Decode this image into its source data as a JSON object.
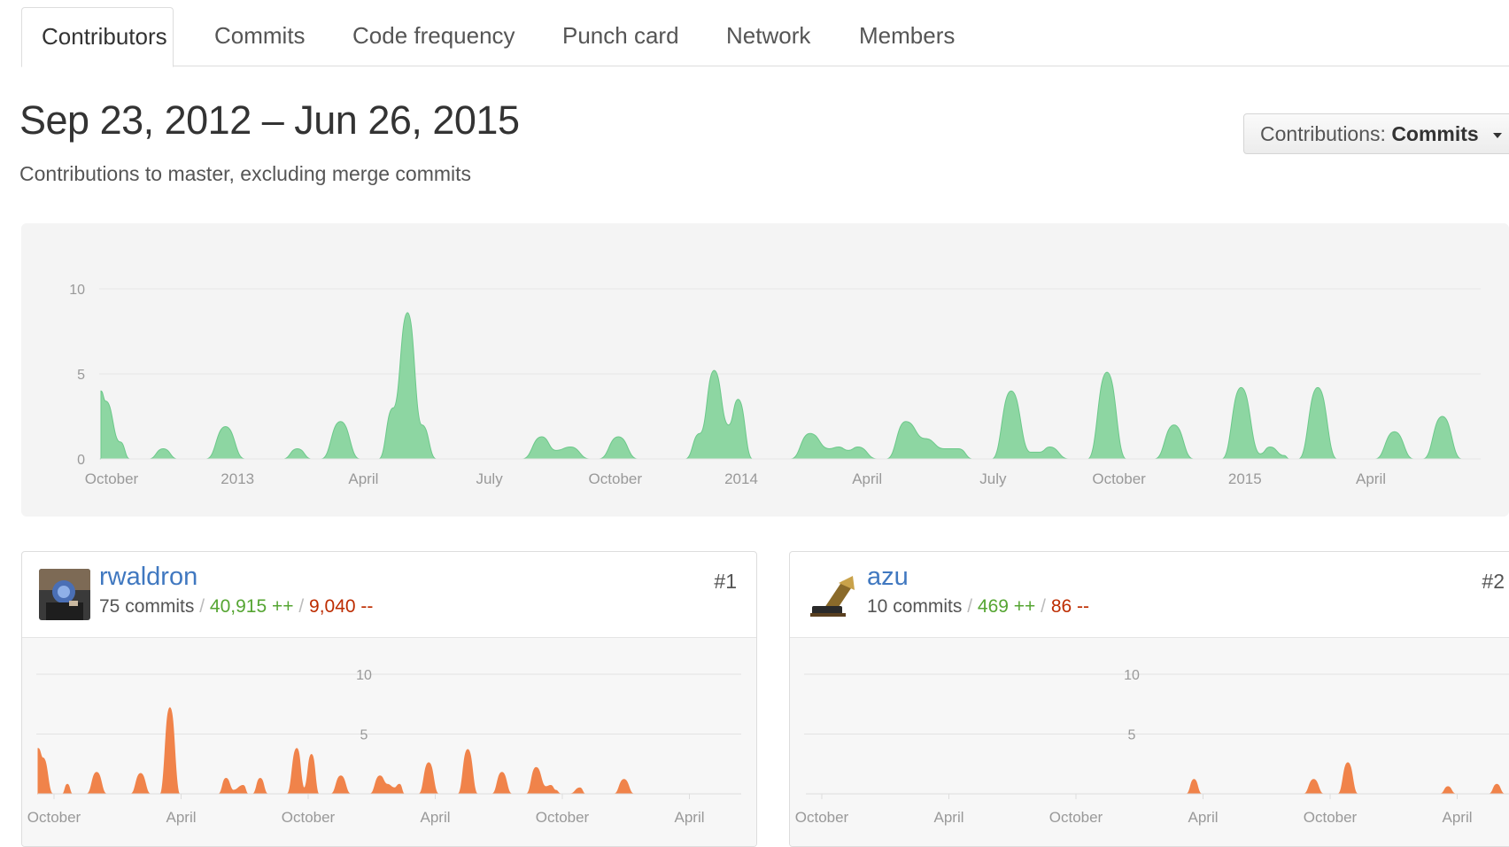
{
  "tabs": [
    {
      "label": "Contributors",
      "active": true
    },
    {
      "label": "Commits",
      "active": false
    },
    {
      "label": "Code frequency",
      "active": false
    },
    {
      "label": "Punch card",
      "active": false
    },
    {
      "label": "Network",
      "active": false
    },
    {
      "label": "Members",
      "active": false
    }
  ],
  "header": {
    "range_title": "Sep 23, 2012 – Jun 26, 2015",
    "subtitle": "Contributions to master, excluding merge commits",
    "contributions_label": "Contributions:",
    "contributions_value": "Commits"
  },
  "colors": {
    "main_area": "#8dd6a2",
    "main_area_stroke": "#6cc88a",
    "contributor_area": "#f0834a",
    "link": "#4078c0",
    "additions": "#55a532",
    "deletions": "#bd2c00"
  },
  "chart_data": [
    {
      "type": "area",
      "title": "",
      "ylim": [
        0,
        10
      ],
      "y_ticks": [
        "0",
        "5",
        "10"
      ],
      "grid": true,
      "x_ticks": [
        "October",
        "2013",
        "April",
        "July",
        "October",
        "2014",
        "April",
        "July",
        "October",
        "2015",
        "April"
      ],
      "x_unit": "weeks since Sep 23, 2012",
      "x_range": [
        0,
        144
      ],
      "series": [
        {
          "points": [
            [
              0,
              4
            ],
            [
              0.5,
              3.4
            ],
            [
              2,
              1
            ],
            [
              3,
              0
            ],
            [
              5,
              0
            ],
            [
              6.5,
              0.6
            ],
            [
              8,
              0
            ],
            [
              11,
              0
            ],
            [
              13,
              1.9
            ],
            [
              15,
              0
            ],
            [
              19,
              0
            ],
            [
              20.5,
              0.6
            ],
            [
              22,
              0
            ],
            [
              23,
              0
            ],
            [
              25,
              2.2
            ],
            [
              27,
              0
            ],
            [
              29,
              0
            ],
            [
              30.5,
              3
            ],
            [
              32,
              8.6
            ],
            [
              33.5,
              2
            ],
            [
              35,
              0
            ],
            [
              44,
              0
            ],
            [
              46,
              1.3
            ],
            [
              47.5,
              0.5
            ],
            [
              49,
              0.7
            ],
            [
              51,
              0
            ],
            [
              52,
              0
            ],
            [
              54,
              1.3
            ],
            [
              56,
              0
            ],
            [
              61,
              0
            ],
            [
              62.5,
              1.5
            ],
            [
              64,
              5.2
            ],
            [
              65.5,
              2
            ],
            [
              66.5,
              3.5
            ],
            [
              68,
              0
            ],
            [
              69,
              0
            ],
            [
              72,
              0
            ],
            [
              74,
              1.5
            ],
            [
              76,
              0.6
            ],
            [
              77,
              0.7
            ],
            [
              78,
              0.5
            ],
            [
              79,
              0.7
            ],
            [
              81,
              0
            ],
            [
              82,
              0
            ],
            [
              84,
              2.2
            ],
            [
              86,
              1.2
            ],
            [
              88,
              0.6
            ],
            [
              89.5,
              0.6
            ],
            [
              91,
              0
            ],
            [
              93,
              0
            ],
            [
              95,
              4
            ],
            [
              97,
              0.4
            ],
            [
              98,
              0.4
            ],
            [
              99,
              0.7
            ],
            [
              101,
              0
            ],
            [
              103,
              0
            ],
            [
              105,
              5.1
            ],
            [
              107,
              0
            ],
            [
              110,
              0
            ],
            [
              112,
              2
            ],
            [
              114,
              0
            ],
            [
              117,
              0
            ],
            [
              119,
              4.2
            ],
            [
              121,
              0.3
            ],
            [
              122,
              0.7
            ],
            [
              123.5,
              0.2
            ],
            [
              124,
              0
            ],
            [
              125,
              0
            ],
            [
              127,
              4.2
            ],
            [
              129,
              0
            ],
            [
              131,
              0
            ],
            [
              133,
              0
            ],
            [
              135,
              1.6
            ],
            [
              137,
              0
            ],
            [
              138,
              0
            ],
            [
              140,
              2.5
            ],
            [
              142,
              0
            ],
            [
              144,
              0
            ]
          ]
        }
      ]
    },
    {
      "type": "area",
      "title": "rwaldron",
      "ylim": [
        0,
        10
      ],
      "y_ticks": [
        "5",
        "10"
      ],
      "grid": true,
      "x_ticks": [
        "October",
        "April",
        "October",
        "April",
        "October",
        "April"
      ],
      "x_unit": "weeks",
      "x_range": [
        0,
        144
      ],
      "series": [
        {
          "points": [
            [
              0,
              3.8
            ],
            [
              1,
              3
            ],
            [
              3,
              0
            ],
            [
              5,
              0
            ],
            [
              6,
              0.8
            ],
            [
              7,
              0
            ],
            [
              10,
              0
            ],
            [
              12,
              1.8
            ],
            [
              14,
              0
            ],
            [
              19,
              0
            ],
            [
              21,
              1.7
            ],
            [
              23,
              0
            ],
            [
              25,
              0
            ],
            [
              27,
              7.2
            ],
            [
              29,
              0
            ],
            [
              37,
              0
            ],
            [
              38.5,
              1.3
            ],
            [
              40,
              0.3
            ],
            [
              42,
              0.7
            ],
            [
              43,
              0
            ],
            [
              44,
              0
            ],
            [
              45.5,
              1.3
            ],
            [
              47,
              0
            ],
            [
              51,
              0
            ],
            [
              53,
              3.8
            ],
            [
              54.5,
              0.5
            ],
            [
              56,
              3.3
            ],
            [
              57.5,
              0
            ],
            [
              60,
              0
            ],
            [
              62,
              1.5
            ],
            [
              64,
              0
            ],
            [
              68,
              0
            ],
            [
              70,
              1.5
            ],
            [
              71.5,
              0.8
            ],
            [
              73,
              0.5
            ],
            [
              74,
              0.8
            ],
            [
              75,
              0
            ],
            [
              78,
              0
            ],
            [
              80,
              2.6
            ],
            [
              82,
              0
            ],
            [
              86,
              0
            ],
            [
              88,
              3.7
            ],
            [
              90,
              0
            ],
            [
              93,
              0
            ],
            [
              95,
              1.8
            ],
            [
              97,
              0
            ],
            [
              100,
              0
            ],
            [
              102,
              2.2
            ],
            [
              104,
              0.6
            ],
            [
              105,
              0.7
            ],
            [
              106,
              0.3
            ],
            [
              107,
              0
            ],
            [
              109,
              0
            ],
            [
              111,
              0.5
            ],
            [
              112,
              0
            ],
            [
              118,
              0
            ],
            [
              120,
              1.2
            ],
            [
              122,
              0
            ],
            [
              144,
              0
            ]
          ]
        }
      ]
    },
    {
      "type": "area",
      "title": "azu",
      "ylim": [
        0,
        10
      ],
      "y_ticks": [
        "5",
        "10"
      ],
      "grid": true,
      "x_ticks": [
        "October",
        "April",
        "October",
        "April",
        "October",
        "April"
      ],
      "x_unit": "weeks",
      "x_range": [
        0,
        144
      ],
      "series": [
        {
          "points": [
            [
              0,
              0
            ],
            [
              78,
              0
            ],
            [
              79.5,
              1.2
            ],
            [
              81,
              0
            ],
            [
              102,
              0
            ],
            [
              104,
              1.2
            ],
            [
              106,
              0
            ],
            [
              109,
              0
            ],
            [
              111,
              2.6
            ],
            [
              113,
              0
            ],
            [
              130,
              0
            ],
            [
              131.5,
              0.6
            ],
            [
              133,
              0
            ],
            [
              140,
              0
            ],
            [
              141.5,
              0.8
            ],
            [
              143,
              0
            ],
            [
              144,
              0
            ]
          ]
        }
      ]
    }
  ],
  "contributors": [
    {
      "login": "rwaldron",
      "commits": "75 commits",
      "additions": "40,915 ++",
      "deletions": "9,040 --",
      "rank": "#1",
      "sep": "/"
    },
    {
      "login": "azu",
      "commits": "10 commits",
      "additions": "469 ++",
      "deletions": "86 --",
      "rank": "#2",
      "sep": "/"
    }
  ]
}
